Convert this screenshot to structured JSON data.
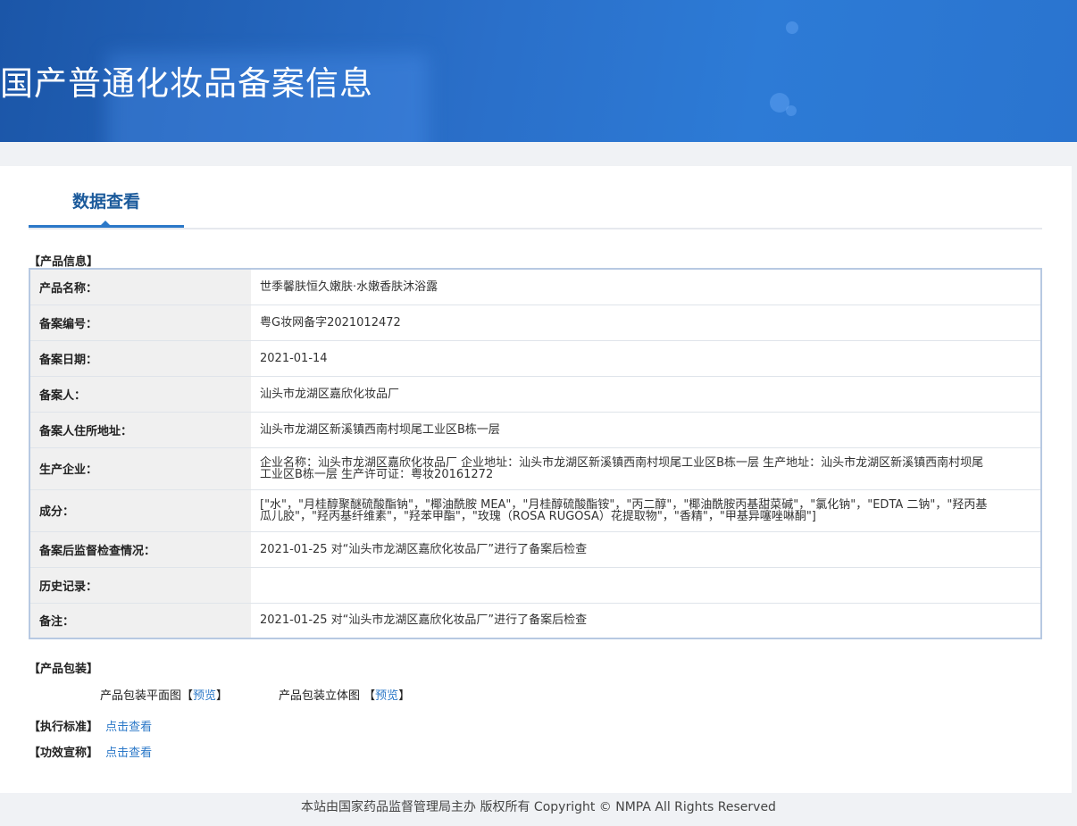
{
  "header": {
    "title": "国产普通化妆品备案信息"
  },
  "tab": {
    "label": "数据查看"
  },
  "product_info": {
    "heading": "【产品信息】",
    "rows": [
      {
        "label": "产品名称：",
        "value": "世季馨肤恒久嫩肤·水嫩香肤沐浴露"
      },
      {
        "label": "备案编号：",
        "value": "粤G妆网备字2021012472"
      },
      {
        "label": "备案日期：",
        "value": "2021-01-14"
      },
      {
        "label": "备案人：",
        "value": "汕头市龙湖区嘉欣化妆品厂"
      },
      {
        "label": "备案人住所地址：",
        "value": "汕头市龙湖区新溪镇西南村坝尾工业区B栋一层"
      },
      {
        "label": "生产企业：",
        "value": "企业名称：汕头市龙湖区嘉欣化妆品厂 企业地址：汕头市龙湖区新溪镇西南村坝尾工业区B栋一层 生产地址：汕头市龙湖区新溪镇西南村坝尾工业区B栋一层 生产许可证：粤妆20161272"
      },
      {
        "label": "成分：",
        "value": "[\"水\"，\"月桂醇聚醚硫酸酯钠\"，\"椰油酰胺 MEA\"，\"月桂醇硫酸酯铵\"，\"丙二醇\"，\"椰油酰胺丙基甜菜碱\"，\"氯化钠\"，\"EDTA 二钠\"，\"羟丙基瓜儿胶\"，\"羟丙基纤维素\"，\"羟苯甲酯\"，\"玫瑰（ROSA RUGOSA）花提取物\"，\"香精\"，\"甲基异噻唑啉酮\"]"
      },
      {
        "label": "备案后监督检查情况：",
        "value": "2021-01-25 对“汕头市龙湖区嘉欣化妆品厂”进行了备案后检查"
      },
      {
        "label": "历史记录：",
        "value": ""
      },
      {
        "label": "备注：",
        "value": "2021-01-25 对“汕头市龙湖区嘉欣化妆品厂”进行了备案后检查"
      }
    ]
  },
  "packaging": {
    "heading": "【产品包装】",
    "flat_label": "产品包装平面图",
    "flat_link": "预览",
    "solid_label": "产品包装立体图",
    "solid_link": "预览",
    "bracket_open": "【",
    "bracket_close": "】"
  },
  "standard": {
    "heading": "【执行标准】",
    "link": "点击查看"
  },
  "efficacy": {
    "heading": "【功效宣称】",
    "link": "点击查看"
  },
  "footer": {
    "text": "本站由国家药品监督管理局主办 版权所有 Copyright © NMPA All Rights Reserved"
  }
}
